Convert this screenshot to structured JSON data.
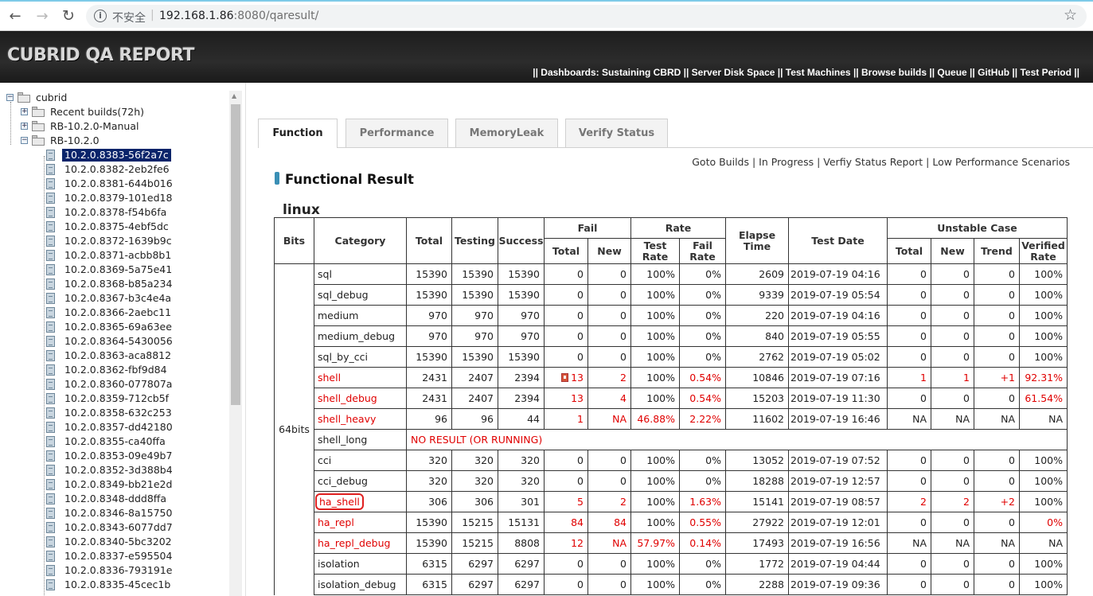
{
  "browser": {
    "insecure_label": "不安全",
    "url_host": "192.168.1.86",
    "url_rest": ":8080/qaresult/"
  },
  "header": {
    "brand": "CUBRID QA REPORT",
    "links_text": "|| Dashboards: Sustaining CBRD || Server Disk Space || Test Machines || Browse builds || Queue || GitHub || Test Period ||"
  },
  "tree": {
    "root": "cubrid",
    "folders": [
      "Recent builds(72h)",
      "RB-10.2.0-Manual",
      "RB-10.2.0"
    ],
    "builds": [
      "10.2.0.8383-56f2a7c",
      "10.2.0.8382-2eb2fe6",
      "10.2.0.8381-644b016",
      "10.2.0.8379-101ed18",
      "10.2.0.8378-f54b6fa",
      "10.2.0.8375-4ebf5dc",
      "10.2.0.8372-1639b9c",
      "10.2.0.8371-acbb8b1",
      "10.2.0.8369-5a75e41",
      "10.2.0.8368-b85a234",
      "10.2.0.8367-b3c4e4a",
      "10.2.0.8366-2aebc11",
      "10.2.0.8365-69a63ee",
      "10.2.0.8364-5430056",
      "10.2.0.8363-aca8812",
      "10.2.0.8362-fbf9d84",
      "10.2.0.8360-077807a",
      "10.2.0.8359-712cb5f",
      "10.2.0.8358-632c253",
      "10.2.0.8357-dd42180",
      "10.2.0.8355-ca40ffa",
      "10.2.0.8353-09e49b7",
      "10.2.0.8352-3d388b4",
      "10.2.0.8349-bb21e2d",
      "10.2.0.8348-ddd8ffa",
      "10.2.0.8346-8a15750",
      "10.2.0.8343-6077dd7",
      "10.2.0.8340-5bc3202",
      "10.2.0.8337-e595504",
      "10.2.0.8336-793191e",
      "10.2.0.8335-45cec1b"
    ],
    "selected_build": "10.2.0.8383-56f2a7c"
  },
  "tabs": [
    "Function",
    "Performance",
    "MemoryLeak",
    "Verify Status"
  ],
  "sub_links": [
    "Goto Builds",
    "In Progress",
    "Verfiy Status Report",
    "Low Performance Scenarios"
  ],
  "section_title": "Functional Result",
  "os": "linux",
  "table": {
    "headers": {
      "bits": "Bits",
      "category": "Category",
      "total": "Total",
      "testing": "Testing",
      "success": "Success",
      "fail": "Fail",
      "fail_total": "Total",
      "fail_new": "New",
      "rate": "Rate",
      "test_rate": "Test Rate",
      "fail_rate": "Fail Rate",
      "elapse": "Elapse Time",
      "test_date": "Test Date",
      "unstable": "Unstable Case",
      "u_total": "Total",
      "u_new": "New",
      "u_trend": "Trend",
      "u_verified": "Verified Rate"
    },
    "bits_value": "64bits",
    "no_result_text": "NO RESULT (OR RUNNING)",
    "rows": [
      {
        "cat": "sql",
        "total": "15390",
        "testing": "15390",
        "success": "15390",
        "ftotal": "0",
        "fnew": "0",
        "trate": "100%",
        "frate": "0%",
        "elapse": "2609",
        "date": "2019-07-19 04:16",
        "ut": "0",
        "un": "0",
        "utr": "0",
        "uv": "100%",
        "red": false
      },
      {
        "cat": "sql_debug",
        "total": "15390",
        "testing": "15390",
        "success": "15390",
        "ftotal": "0",
        "fnew": "0",
        "trate": "100%",
        "frate": "0%",
        "elapse": "9339",
        "date": "2019-07-19 05:54",
        "ut": "0",
        "un": "0",
        "utr": "0",
        "uv": "100%",
        "red": false
      },
      {
        "cat": "medium",
        "total": "970",
        "testing": "970",
        "success": "970",
        "ftotal": "0",
        "fnew": "0",
        "trate": "100%",
        "frate": "0%",
        "elapse": "220",
        "date": "2019-07-19 04:16",
        "ut": "0",
        "un": "0",
        "utr": "0",
        "uv": "100%",
        "red": false
      },
      {
        "cat": "medium_debug",
        "total": "970",
        "testing": "970",
        "success": "970",
        "ftotal": "0",
        "fnew": "0",
        "trate": "100%",
        "frate": "0%",
        "elapse": "840",
        "date": "2019-07-19 05:55",
        "ut": "0",
        "un": "0",
        "utr": "0",
        "uv": "100%",
        "red": false
      },
      {
        "cat": "sql_by_cci",
        "total": "15390",
        "testing": "15390",
        "success": "15390",
        "ftotal": "0",
        "fnew": "0",
        "trate": "100%",
        "frate": "0%",
        "elapse": "2762",
        "date": "2019-07-19 05:02",
        "ut": "0",
        "un": "0",
        "utr": "0",
        "uv": "100%",
        "red": false
      },
      {
        "cat": "shell",
        "total": "2431",
        "testing": "2407",
        "success": "2394",
        "ftotal": "13",
        "fnew": "2",
        "trate": "100%",
        "frate": "0.54%",
        "elapse": "10846",
        "date": "2019-07-19 07:16",
        "ut": "1",
        "un": "1",
        "utr": "+1",
        "uv": "92.31%",
        "red": true,
        "icon": true,
        "rate_red": true,
        "u_red": true,
        "uv_red": true
      },
      {
        "cat": "shell_debug",
        "total": "2431",
        "testing": "2407",
        "success": "2394",
        "ftotal": "13",
        "fnew": "4",
        "trate": "100%",
        "frate": "0.54%",
        "elapse": "15203",
        "date": "2019-07-19 11:30",
        "ut": "0",
        "un": "0",
        "utr": "0",
        "uv": "61.54%",
        "red": true,
        "rate_red": true,
        "uv_red": true
      },
      {
        "cat": "shell_heavy",
        "total": "96",
        "testing": "96",
        "success": "44",
        "ftotal": "1",
        "fnew": "NA",
        "trate": "46.88%",
        "frate": "2.22%",
        "elapse": "11602",
        "date": "2019-07-19 16:46",
        "ut": "NA",
        "un": "NA",
        "utr": "NA",
        "uv": "NA",
        "red": true,
        "rate_red": true,
        "trate_red": true
      },
      {
        "cat": "shell_long",
        "noresult": true
      },
      {
        "cat": "cci",
        "total": "320",
        "testing": "320",
        "success": "320",
        "ftotal": "0",
        "fnew": "0",
        "trate": "100%",
        "frate": "0%",
        "elapse": "13052",
        "date": "2019-07-19 07:52",
        "ut": "0",
        "un": "0",
        "utr": "0",
        "uv": "100%",
        "red": false
      },
      {
        "cat": "cci_debug",
        "total": "320",
        "testing": "320",
        "success": "320",
        "ftotal": "0",
        "fnew": "0",
        "trate": "100%",
        "frate": "0%",
        "elapse": "18288",
        "date": "2019-07-19 12:57",
        "ut": "0",
        "un": "0",
        "utr": "0",
        "uv": "100%",
        "red": false
      },
      {
        "cat": "ha_shell",
        "total": "306",
        "testing": "306",
        "success": "301",
        "ftotal": "5",
        "fnew": "2",
        "trate": "100%",
        "frate": "1.63%",
        "elapse": "15141",
        "date": "2019-07-19 08:57",
        "ut": "2",
        "un": "2",
        "utr": "+2",
        "uv": "100%",
        "red": true,
        "highlight": true,
        "rate_red": true,
        "u_red": true
      },
      {
        "cat": "ha_repl",
        "total": "15390",
        "testing": "15215",
        "success": "15131",
        "ftotal": "84",
        "fnew": "84",
        "trate": "100%",
        "frate": "0.55%",
        "elapse": "27922",
        "date": "2019-07-19 12:01",
        "ut": "0",
        "un": "0",
        "utr": "0",
        "uv": "0%",
        "red": true,
        "rate_red": true,
        "uv_red": true
      },
      {
        "cat": "ha_repl_debug",
        "total": "15390",
        "testing": "15215",
        "success": "8808",
        "ftotal": "12",
        "fnew": "NA",
        "trate": "57.97%",
        "frate": "0.14%",
        "elapse": "17493",
        "date": "2019-07-19 16:56",
        "ut": "NA",
        "un": "NA",
        "utr": "NA",
        "uv": "NA",
        "red": true,
        "rate_red": true,
        "trate_red": true
      },
      {
        "cat": "isolation",
        "total": "6315",
        "testing": "6297",
        "success": "6297",
        "ftotal": "0",
        "fnew": "0",
        "trate": "100%",
        "frate": "0%",
        "elapse": "1772",
        "date": "2019-07-19 04:44",
        "ut": "0",
        "un": "0",
        "utr": "0",
        "uv": "100%",
        "red": false
      },
      {
        "cat": "isolation_debug",
        "total": "6315",
        "testing": "6297",
        "success": "6297",
        "ftotal": "0",
        "fnew": "0",
        "trate": "100%",
        "frate": "0%",
        "elapse": "2288",
        "date": "2019-07-19 09:36",
        "ut": "0",
        "un": "0",
        "utr": "0",
        "uv": "100%",
        "red": false
      }
    ]
  }
}
